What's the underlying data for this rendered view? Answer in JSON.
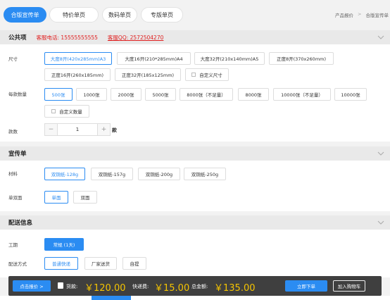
{
  "tabs": [
    {
      "label": "合版宣传单",
      "active": true
    },
    {
      "label": "特价单页",
      "active": false
    },
    {
      "label": "数码单页",
      "active": false
    },
    {
      "label": "专版单页",
      "active": false
    }
  ],
  "breadcrumb": {
    "parent": "产品报价",
    "separator": ">",
    "current": "合版宣传单"
  },
  "common": {
    "title": "公共项",
    "phone": "客服电话: 15555555555",
    "qq": "客服QQ: 2572504270",
    "size_label": "尺寸",
    "sizes": [
      {
        "label": "大度8开(420x285mm)A3",
        "selected": true
      },
      {
        "label": "大度16开(210*285mm)A4",
        "selected": false
      },
      {
        "label": "大度32开(210x140mm)A5",
        "selected": false
      },
      {
        "label": "正度8开(370x260mm)",
        "selected": false
      },
      {
        "label": "正度16开(260x185mm)",
        "selected": false
      },
      {
        "label": "正度32开(185x125mm)",
        "selected": false
      },
      {
        "label": "自定义尺寸",
        "selected": false
      }
    ],
    "qty_label": "每款数量",
    "qtys": [
      {
        "label": "500张",
        "selected": true
      },
      {
        "label": "1000张",
        "selected": false
      },
      {
        "label": "2000张",
        "selected": false
      },
      {
        "label": "5000张",
        "selected": false
      },
      {
        "label": "8000张（不足量）",
        "selected": false
      },
      {
        "label": "8000张",
        "selected": false
      },
      {
        "label": "10000张（不足量）",
        "selected": false
      },
      {
        "label": "10000张",
        "selected": false
      },
      {
        "label": "自定义数量",
        "selected": false
      }
    ],
    "kinds_label": "款数",
    "kinds_value": "1",
    "kinds_unit": "款",
    "minus": "−",
    "plus": "+"
  },
  "flyer": {
    "title": "宣传单",
    "material_label": "材料",
    "materials": [
      {
        "label": "双铜纸-128g",
        "selected": true
      },
      {
        "label": "双铜纸-157g",
        "selected": false
      },
      {
        "label": "双铜纸-200g",
        "selected": false
      },
      {
        "label": "双铜纸-250g",
        "selected": false
      }
    ],
    "sides_label": "单双面",
    "sides": [
      {
        "label": "单面",
        "selected": true
      },
      {
        "label": "双面",
        "selected": false
      }
    ]
  },
  "delivery": {
    "title": "配送信息",
    "period_label": "工期",
    "period": "常规 (1天)",
    "method_label": "配送方式",
    "methods": [
      {
        "label": "普通快递",
        "selected": true
      },
      {
        "label": "厂家送货",
        "selected": false
      },
      {
        "label": "自提",
        "selected": false
      }
    ]
  },
  "bottom": {
    "quote_button": "点击报价 >",
    "goods_label": "货款:",
    "goods_amount": "￥120.00",
    "shipping_label": "快递费:",
    "shipping_amount": "￥15.00",
    "total_label": "总金额:",
    "total_amount": "￥135.00",
    "order_button": "立即下单",
    "cart_button": "加入购物车"
  },
  "colors": {
    "accent": "#2b8cf2",
    "warning": "#e02020",
    "price": "#f5c400",
    "bar": "#3f3f3f"
  },
  "icons": {
    "collapse": "chevron-down-icon",
    "document": "document-icon"
  }
}
